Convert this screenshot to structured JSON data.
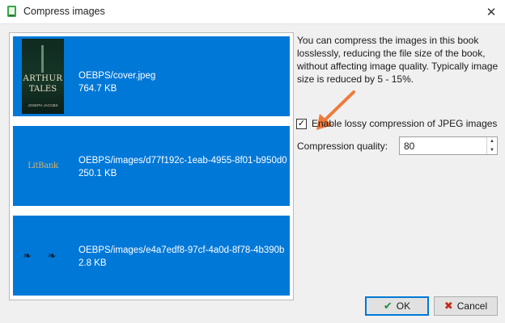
{
  "window": {
    "title": "Compress images",
    "icon": "calibre-app-icon",
    "close_icon": "close-icon"
  },
  "images": [
    {
      "path": "OEBPS/cover.jpeg",
      "size": "764.7 KB",
      "thumb": "book-cover",
      "cover_title_1": "ARTHUR",
      "cover_title_2": "TALES",
      "cover_author": "JOSEPH JACOBS"
    },
    {
      "path": "OEBPS/images/d77f192c-1eab-4955-8f01-b950d0",
      "size": "250.1 KB",
      "thumb": "publisher-logo",
      "logo_text": "LitBank"
    },
    {
      "path": "OEBPS/images/e4a7edf8-97cf-4a0d-8f78-4b390b",
      "size": "2.8 KB",
      "thumb": "ornament-divider",
      "ornament_text": "❧ ❧"
    }
  ],
  "description": "You can compress the images in this book losslessly, reducing the file size of the book, without affecting image quality. Typically image size is reduced by 5 - 15%.",
  "lossy": {
    "checked": true,
    "label": "Enable lossy compression of JPEG images",
    "check_glyph": "✓"
  },
  "quality": {
    "label": "Compression quality:",
    "value": "80"
  },
  "buttons": {
    "ok_label": "OK",
    "cancel_label": "Cancel"
  },
  "colors": {
    "selection": "#0078d7",
    "arrow": "#ee7b3b"
  }
}
